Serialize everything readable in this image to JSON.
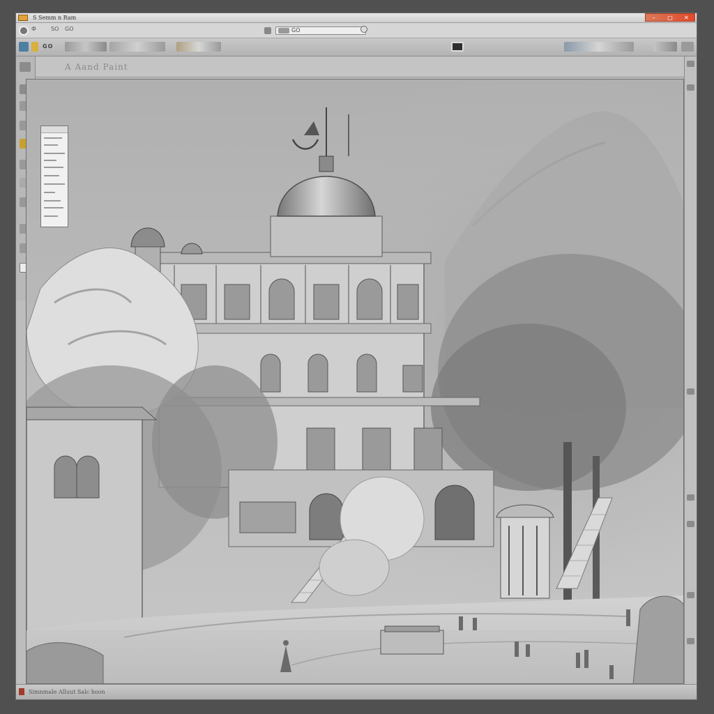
{
  "window": {
    "title": "S Semm n Ram",
    "controls": [
      "–",
      "□",
      "✕"
    ],
    "accent": "#e14a2a"
  },
  "menubar": {
    "items": [
      "Ф",
      "SO",
      "GO"
    ],
    "url": "GO"
  },
  "toolbar": {
    "left_label": "GO",
    "right_label": ""
  },
  "secondbar": {
    "text": "A  Aand  Paint"
  },
  "floatpanel": {
    "header": "",
    "lines": 14
  },
  "status": {
    "text": "Simnmale  Alluut  Salc  hoon"
  },
  "icons": [
    "app-icon",
    "gear-icon",
    "zoom-icon",
    "brush-icon",
    "layers-icon",
    "eye-icon"
  ],
  "palette": {
    "chrome": "#bdbdbd",
    "dark": "#505050",
    "canvas_sky": "#b7b7b7"
  }
}
